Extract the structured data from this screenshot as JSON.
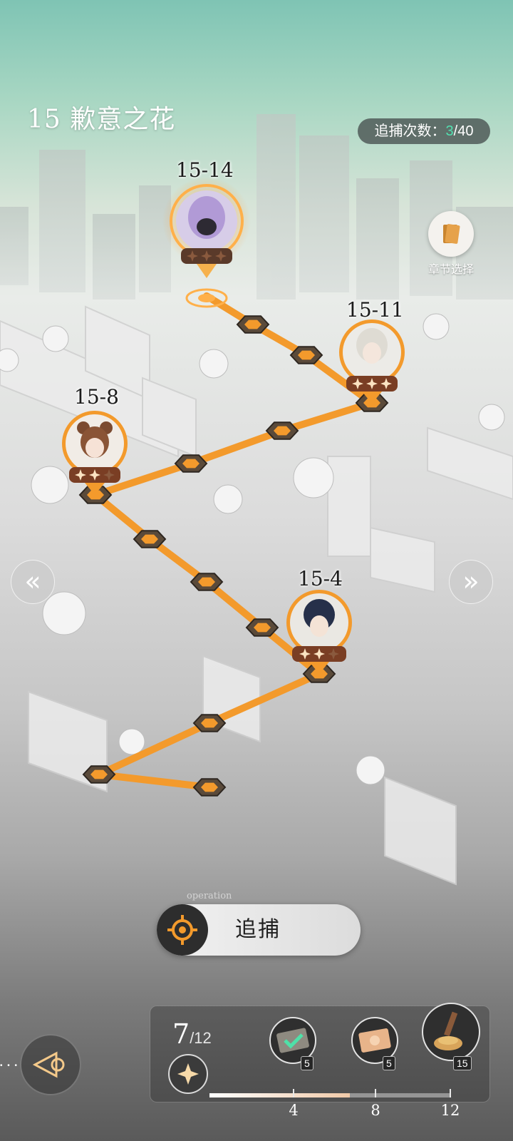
{
  "header": {
    "chapter_title": "15 歉意之花",
    "arrest_label": "追捕次数：",
    "arrest_current": "3",
    "arrest_total": "/40"
  },
  "chapter_select": {
    "label": "章节选择",
    "icon": "book-icon"
  },
  "stages": [
    {
      "label": "15-14",
      "character": "purple-hair-boss",
      "stars": 0,
      "state": "current"
    },
    {
      "label": "15-11",
      "character": "silver-hair-man",
      "stars": 3,
      "state": "cleared"
    },
    {
      "label": "15-8",
      "character": "brown-bun-girl",
      "stars": 2,
      "state": "cleared"
    },
    {
      "label": "15-4",
      "character": "dark-hair-man",
      "stars": 2,
      "state": "cleared"
    }
  ],
  "navigation": {
    "prev": "«",
    "next": "»"
  },
  "action": {
    "watermark": "operation",
    "pursue_label": "追捕"
  },
  "star_progress": {
    "current": "7",
    "total": "/12",
    "fraction": 0.583,
    "milestones": [
      {
        "threshold": "4",
        "qty": "5",
        "icon": "stamp-card-icon",
        "claimed": true
      },
      {
        "threshold": "8",
        "qty": "5",
        "icon": "ticket-card-icon",
        "claimed": false
      },
      {
        "threshold": "12",
        "qty": "15",
        "icon": "wax-seal-icon",
        "claimed": false
      }
    ]
  },
  "colors": {
    "path": "#f39a2c",
    "accent_green": "#52e0b0",
    "node_dark": "#5a4a3a"
  }
}
